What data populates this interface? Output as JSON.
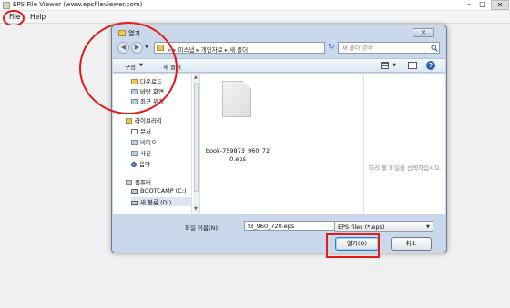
{
  "app": {
    "title": "EPS File Viewer (www.epsfileviewer.com)",
    "min": "–",
    "max": "□",
    "close": "✕"
  },
  "menu": {
    "file": "File",
    "help": "Help"
  },
  "dialog": {
    "title": "열기",
    "close": "✕",
    "nav": {
      "back": "◀",
      "forward": "▶",
      "history": "▼"
    },
    "address": {
      "prefix": "«",
      "segments": [
        "피스냅",
        "개인자료",
        "새 폴더"
      ],
      "separator": "▸",
      "dropdown": "▼",
      "refresh": "↻"
    },
    "search": {
      "placeholder": "새 폴더 검색"
    },
    "toolbar": {
      "organize": "구성",
      "organize_arrow": "▼",
      "new_folder": "새 폴더",
      "view_arrow": "▼",
      "help": "?"
    },
    "nav_pane": {
      "items": [
        {
          "label": "다운로드",
          "icon": "downloads-icon"
        },
        {
          "label": "바탕 화면",
          "icon": "desktop-icon"
        },
        {
          "label": "최근 위치",
          "icon": "recent-places-icon"
        },
        {
          "label": "라이브러리",
          "icon": "libraries-icon"
        },
        {
          "label": "문서",
          "icon": "documents-icon"
        },
        {
          "label": "비디오",
          "icon": "videos-icon"
        },
        {
          "label": "사진",
          "icon": "pictures-icon"
        },
        {
          "label": "음악",
          "icon": "music-icon"
        },
        {
          "label": "컴퓨터",
          "icon": "computer-icon"
        },
        {
          "label": "BOOTCAMP (C:)",
          "icon": "drive-icon"
        },
        {
          "label": "새 볼륨 (D:)",
          "icon": "drive-icon"
        }
      ],
      "scroll_up": "▲",
      "scroll_down": "▼"
    },
    "file": {
      "name": "book-759873_960_720.eps",
      "icon": "document-file-icon"
    },
    "preview_text": "미리 볼 파일을 선택하십시오.",
    "filename": {
      "label": "파일 이름(N):",
      "value": "f3_960_720.eps",
      "arrow": "▼"
    },
    "filetype": {
      "value": "EPS files (*.eps)",
      "arrow": "▼"
    },
    "buttons": {
      "open": "열기(O)",
      "cancel": "취소"
    }
  },
  "colors": {
    "annotation": "#e21b1b",
    "dialog_frame": "#c9d8ea",
    "accent": "#3a7bc7"
  }
}
